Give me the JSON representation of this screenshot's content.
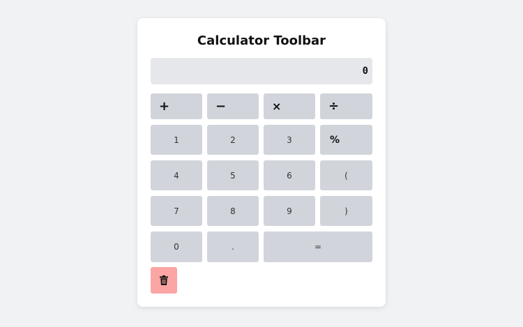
{
  "title": "Calculator Toolbar",
  "display": {
    "value": "0"
  },
  "operators": {
    "add": "+",
    "subtract": "−",
    "multiply": "×",
    "divide": "÷"
  },
  "keys": {
    "one": "1",
    "two": "2",
    "three": "3",
    "percent": "%",
    "four": "4",
    "five": "5",
    "six": "6",
    "open_paren": "(",
    "seven": "7",
    "eight": "8",
    "nine": "9",
    "close_paren": ")",
    "zero": "0",
    "decimal": ".",
    "equals": "="
  },
  "icons": {
    "clear": "trash-icon"
  },
  "colors": {
    "page_bg": "#f1f2f4",
    "card_bg": "#ffffff",
    "display_bg": "#e5e7eb",
    "button_bg": "#d1d5db",
    "clear_bg": "#fca5a5"
  }
}
